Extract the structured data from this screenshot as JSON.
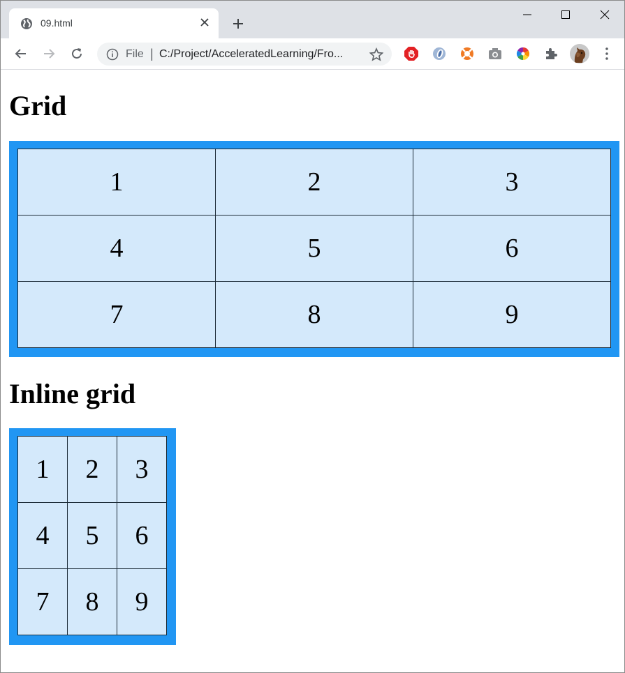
{
  "browser": {
    "tab_title": "09.html",
    "address_scheme": "File",
    "address_url": "C:/Project/AcceleratedLearning/Fro...",
    "extensions": [
      "adblock-icon",
      "opera-icon",
      "lifebuoy-icon",
      "camera-icon",
      "color-wheel-icon",
      "extensions-puzzle-icon",
      "profile-avatar"
    ]
  },
  "page": {
    "heading_grid": "Grid",
    "heading_inline": "Inline grid",
    "grid_cells": [
      "1",
      "2",
      "3",
      "4",
      "5",
      "6",
      "7",
      "8",
      "9"
    ],
    "inline_grid_cells": [
      "1",
      "2",
      "3",
      "4",
      "5",
      "6",
      "7",
      "8",
      "9"
    ],
    "colors": {
      "grid_border": "#2196f3",
      "cell_background": "#d4e9fb"
    }
  }
}
